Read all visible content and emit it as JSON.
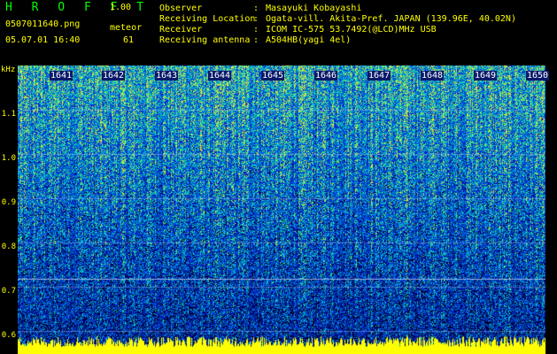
{
  "header": {
    "app_title": "H R O F F T",
    "version": "1.00",
    "filename": "0507011640.png",
    "meteor_label": "meteor",
    "date_time": "05.07.01 16:40",
    "meteor_count": "61"
  },
  "info": [
    {
      "key": "Observer",
      "value": "Masayuki Kobayashi"
    },
    {
      "key": "Receiving Location",
      "value": "Ogata-vill. Akita-Pref. JAPAN (139.96E, 40.02N)"
    },
    {
      "key": "Receiver",
      "value": "ICOM IC-575 53.7492(@LCD)MHz USB"
    },
    {
      "key": "Receiving antenna",
      "value": "A504HB(yagi 4el)"
    }
  ],
  "spectrogram": {
    "y_unit": "kHz",
    "y_ticks": [
      "1.1",
      "1.0",
      "0.9",
      "0.8",
      "0.7",
      "0.6"
    ],
    "x_ticks": [
      "1641",
      "1642",
      "1643",
      "1644",
      "1645",
      "1646",
      "1647",
      "1648",
      "1649",
      "1650"
    ],
    "colors": {
      "background": "#000000",
      "text": "#ffff00",
      "title": "#00ff00",
      "noise_floor": "#ffff00"
    }
  }
}
